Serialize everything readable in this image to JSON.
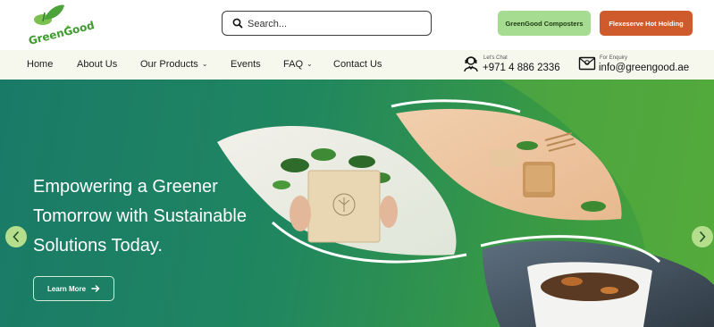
{
  "logo": {
    "text": "GreenGood",
    "icon": "leaf-sprout-logo-icon"
  },
  "search": {
    "placeholder": "Search...",
    "icon": "search-icon"
  },
  "header_buttons": {
    "composters_label": "GreenGood Composters",
    "flexeserve_label": "Flexeserve Hot Holding"
  },
  "nav": {
    "items": [
      {
        "label": "Home",
        "has_dropdown": false
      },
      {
        "label": "About Us",
        "has_dropdown": false
      },
      {
        "label": "Our Products",
        "has_dropdown": true
      },
      {
        "label": "Events",
        "has_dropdown": false
      },
      {
        "label": "FAQ",
        "has_dropdown": true
      },
      {
        "label": "Contact Us",
        "has_dropdown": false
      }
    ],
    "chat": {
      "label": "Let's Chat",
      "value": "+971 4 886 2336",
      "icon": "support-agent-icon"
    },
    "enquiry": {
      "label": "For Enquiry",
      "value": "info@greengood.ae",
      "icon": "mail-icon"
    }
  },
  "hero": {
    "headline_lines": [
      "Empowering a Greener",
      "Tomorrow with Sustainable",
      "Solutions Today."
    ],
    "cta_label": "Learn More",
    "cta_icon": "arrow-right-icon",
    "prev_icon": "chevron-left-icon",
    "next_icon": "chevron-right-icon"
  },
  "colors": {
    "brand_green": "#3e9a2f",
    "composters_button": "#a6dc92",
    "flexeserve_button": "#cf5a2b",
    "navbar_bg": "#f6f8ee",
    "hero_gradient_start": "#1a7a68",
    "hero_gradient_end": "#4aa53a"
  }
}
